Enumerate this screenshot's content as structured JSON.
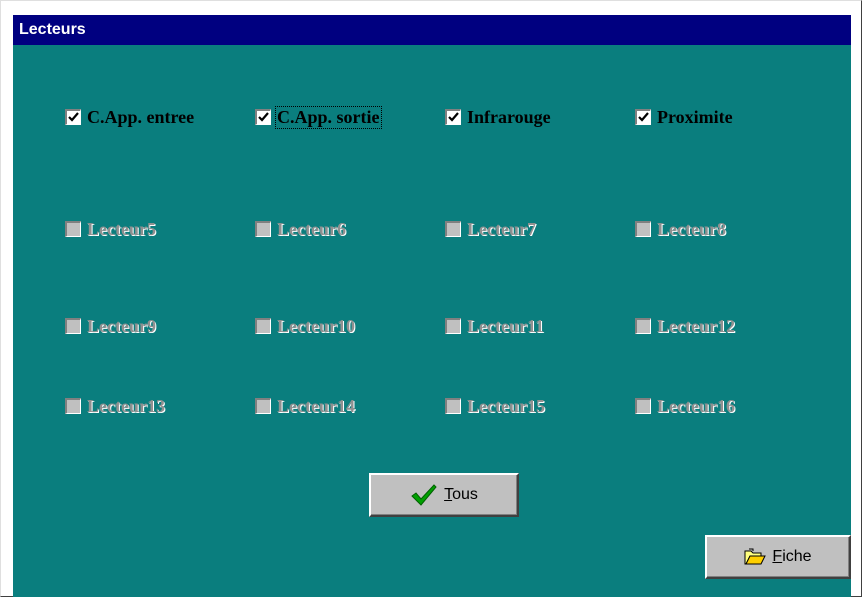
{
  "window": {
    "title": "Lecteurs"
  },
  "readers": [
    {
      "label": "C.App. entree",
      "checked": true,
      "enabled": true,
      "focused": false
    },
    {
      "label": "C.App. sortie",
      "checked": true,
      "enabled": true,
      "focused": true
    },
    {
      "label": "Infrarouge",
      "checked": true,
      "enabled": true,
      "focused": false
    },
    {
      "label": "Proximite",
      "checked": true,
      "enabled": true,
      "focused": false
    },
    {
      "label": "Lecteur5",
      "checked": false,
      "enabled": false,
      "focused": false
    },
    {
      "label": "Lecteur6",
      "checked": false,
      "enabled": false,
      "focused": false
    },
    {
      "label": "Lecteur7",
      "checked": false,
      "enabled": false,
      "focused": false
    },
    {
      "label": "Lecteur8",
      "checked": false,
      "enabled": false,
      "focused": false
    },
    {
      "label": "Lecteur9",
      "checked": false,
      "enabled": false,
      "focused": false
    },
    {
      "label": "Lecteur10",
      "checked": false,
      "enabled": false,
      "focused": false
    },
    {
      "label": "Lecteur11",
      "checked": false,
      "enabled": false,
      "focused": false
    },
    {
      "label": "Lecteur12",
      "checked": false,
      "enabled": false,
      "focused": false
    },
    {
      "label": "Lecteur13",
      "checked": false,
      "enabled": false,
      "focused": false
    },
    {
      "label": "Lecteur14",
      "checked": false,
      "enabled": false,
      "focused": false
    },
    {
      "label": "Lecteur15",
      "checked": false,
      "enabled": false,
      "focused": false
    },
    {
      "label": "Lecteur16",
      "checked": false,
      "enabled": false,
      "focused": false
    }
  ],
  "buttons": {
    "tous": {
      "mnemonic": "T",
      "rest": "ous",
      "icon": "checkmark-icon"
    },
    "fiche": {
      "mnemonic": "F",
      "rest": "iche",
      "icon": "folder-icon"
    }
  },
  "colors": {
    "titlebar": "#000080",
    "client": "#0a7e7e",
    "checkmark_green": "#00a000"
  }
}
